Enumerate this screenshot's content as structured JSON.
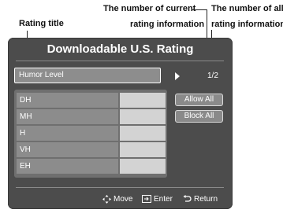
{
  "callouts": {
    "rating_title": "Rating title",
    "current_line1": "The number of current",
    "current_line2": "rating information",
    "all_line1": "The number of all",
    "all_line2": "rating information"
  },
  "screen": {
    "title": "Downloadable U.S. Rating",
    "selector_label": "Humor Level",
    "page_current": "1",
    "page_total": "2",
    "page_indicator": "1/2",
    "rows": [
      {
        "label": "DH"
      },
      {
        "label": "MH"
      },
      {
        "label": "H"
      },
      {
        "label": "VH"
      },
      {
        "label": "EH"
      }
    ],
    "buttons": {
      "allow_all": "Allow All",
      "block_all": "Block All"
    },
    "footer": {
      "move": "Move",
      "enter": "Enter",
      "return": "Return"
    }
  },
  "colors": {
    "panel": "#4c4c4c",
    "row_label_bg": "#8c8c8c",
    "row_cell_bg": "#d3d3d3",
    "text": "#ffffff"
  }
}
